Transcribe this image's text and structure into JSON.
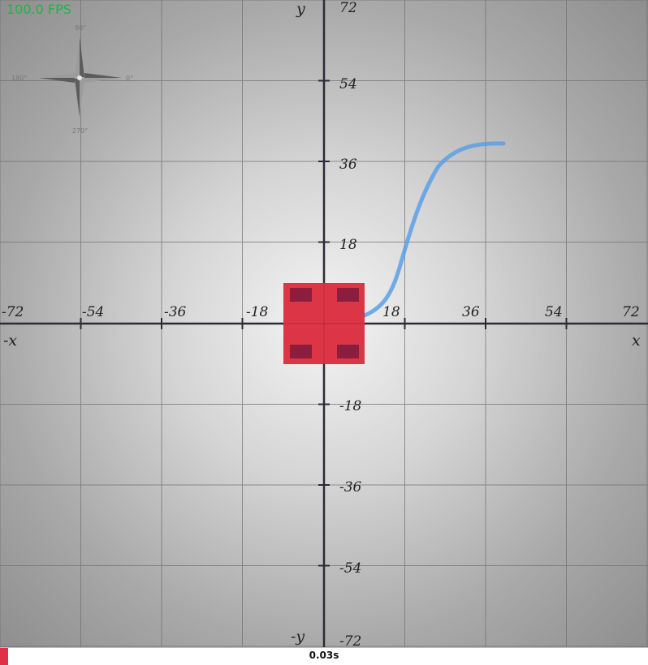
{
  "fps_text": "100.0 FPS",
  "axes": {
    "x_label": "x",
    "x_neg_label": "-x",
    "y_label": "y",
    "y_neg_label": "-y",
    "x_ticks": [
      "-72",
      "-54",
      "-36",
      "-18",
      "18",
      "36",
      "54",
      "72"
    ],
    "y_ticks": [
      "72",
      "54",
      "36",
      "18",
      "-18",
      "-36",
      "-54",
      "-72"
    ]
  },
  "compass": {
    "north": "90°",
    "east": "0°",
    "west": "180°",
    "south": "270°"
  },
  "robot": {
    "color": "#dc3545",
    "wheel_color": "#8b1d3f"
  },
  "trajectory": {
    "color": "#5aa0e6"
  },
  "timebar": {
    "label": "0.03s",
    "progress": 0.012,
    "color": "#e03045"
  }
}
